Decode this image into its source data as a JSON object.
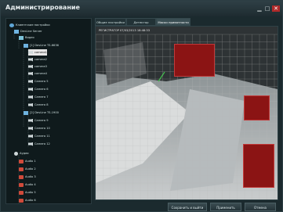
{
  "window": {
    "title": "Администрирование"
  },
  "tree": {
    "items": [
      {
        "label": "Клиентские настройки",
        "icon": "gear-icon"
      },
      {
        "label": "DevLine Server",
        "icon": "server-icon"
      },
      {
        "label": "Видео",
        "icon": "video-icon"
      },
      {
        "label": "[1] DevLine TS-6636",
        "icon": "device-icon"
      },
      {
        "label": "camera1",
        "icon": "camera-icon"
      },
      {
        "label": "camera2",
        "icon": "camera-icon"
      },
      {
        "label": "camera3",
        "icon": "camera-icon"
      },
      {
        "label": "camera4",
        "icon": "camera-icon"
      },
      {
        "label": "Camera 5",
        "icon": "camera-icon"
      },
      {
        "label": "Camera 6",
        "icon": "camera-icon"
      },
      {
        "label": "Camera 7",
        "icon": "camera-icon"
      },
      {
        "label": "Camera 8",
        "icon": "camera-icon"
      },
      {
        "label": "[2] DevLine TS-1900",
        "icon": "device-icon"
      },
      {
        "label": "Camera 9",
        "icon": "camera-icon"
      },
      {
        "label": "Camera 10",
        "icon": "camera-icon"
      },
      {
        "label": "Camera 11",
        "icon": "camera-icon"
      },
      {
        "label": "Camera 12",
        "icon": "camera-icon"
      },
      {
        "label": "Аудио",
        "icon": "audio-icon"
      },
      {
        "label": "Audio 1",
        "icon": "mic-icon"
      },
      {
        "label": "Audio 2",
        "icon": "mic-icon"
      },
      {
        "label": "Audio 3",
        "icon": "mic-icon"
      },
      {
        "label": "Audio 4",
        "icon": "mic-icon"
      },
      {
        "label": "Audio 5",
        "icon": "mic-icon"
      },
      {
        "label": "Audio 6",
        "icon": "mic-icon"
      }
    ],
    "selected": "camera1"
  },
  "tabs": [
    {
      "label": "Общие настройки"
    },
    {
      "label": "Детектор движения"
    },
    {
      "label": "Маски приватности",
      "active": true
    }
  ],
  "video": {
    "timestamp": "РЕГИСТРАТОР 07/03/2013 18:48:33"
  },
  "buttons": {
    "save_exit": "Сохранить и выйти",
    "apply": "Применить",
    "cancel": "Отмена"
  },
  "colors": {
    "mask_fill": "#8b1414",
    "mask_border": "#c23a3a",
    "grid": "#b9b9b9"
  }
}
